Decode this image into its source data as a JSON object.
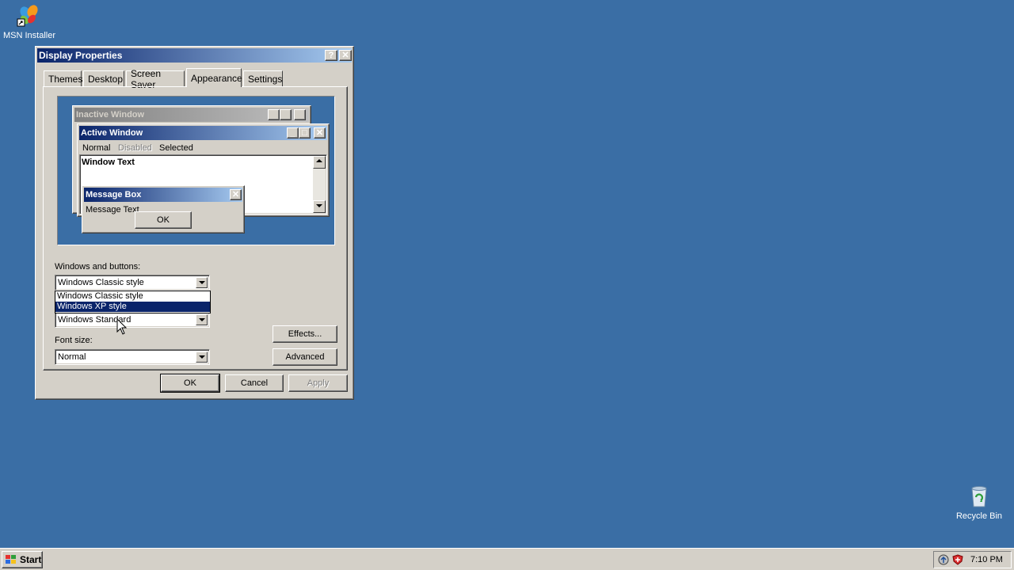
{
  "desktop": {
    "icons": [
      {
        "label": "MSN Installer",
        "icon": "msn-butterfly-icon"
      },
      {
        "label": "Recycle Bin",
        "icon": "recycle-bin-icon"
      }
    ],
    "background": "#3a6ea5"
  },
  "dialog": {
    "title": "Display Properties",
    "help_glyph": "?",
    "close_glyph": "✕",
    "tabs": [
      "Themes",
      "Desktop",
      "Screen Saver",
      "Appearance",
      "Settings"
    ],
    "active_tab": "Appearance",
    "preview": {
      "inactive_title": "Inactive Window",
      "active_title": "Active Window",
      "menu": [
        "Normal",
        "Disabled",
        "Selected"
      ],
      "window_text": "Window Text",
      "msgbox_title": "Message Box",
      "msgbox_text": "Message Text",
      "msgbox_ok": "OK",
      "min_glyph": "_",
      "max_glyph": "□",
      "close_glyph": "✕"
    },
    "windows_buttons_label": "Windows and buttons:",
    "windows_buttons_value": "Windows Classic style",
    "windows_buttons_options": [
      "Windows Classic style",
      "Windows XP style"
    ],
    "color_scheme_value": "Windows Standard",
    "font_size_label": "Font size:",
    "font_size_value": "Normal",
    "effects_button": "Effects...",
    "advanced_button": "Advanced",
    "ok_button": "OK",
    "cancel_button": "Cancel",
    "apply_button": "Apply"
  },
  "taskbar": {
    "start_label": "Start",
    "clock": "7:10 PM"
  }
}
